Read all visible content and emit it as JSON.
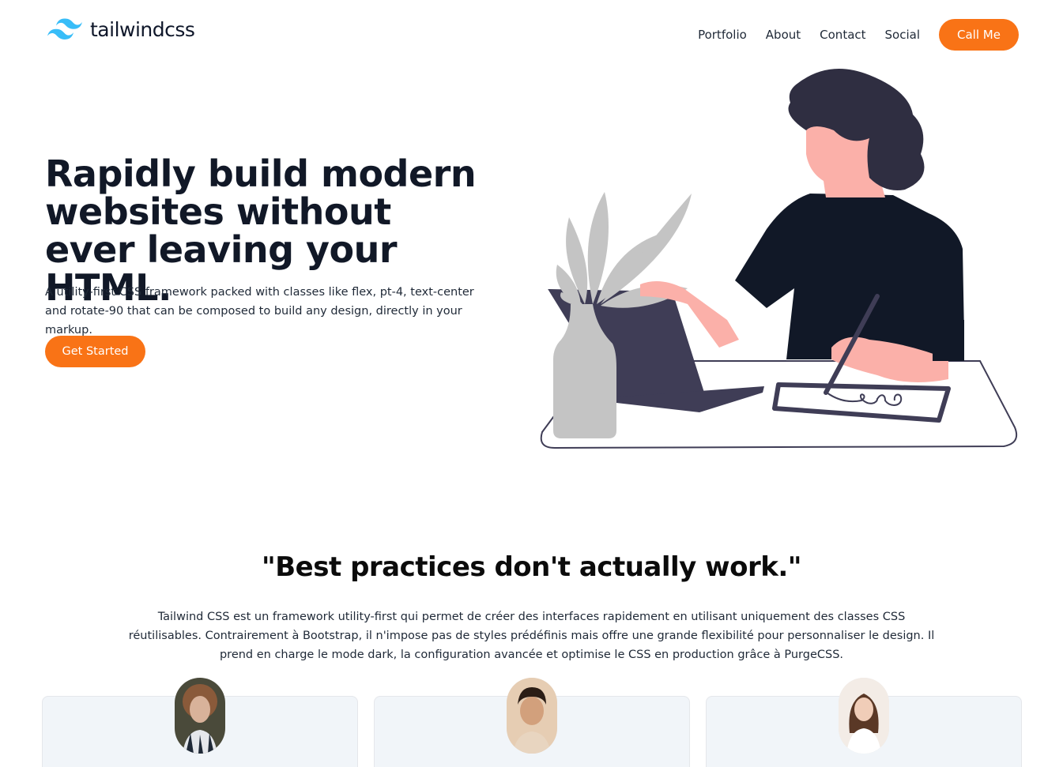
{
  "header": {
    "logo_text": "tailwindcss",
    "nav": [
      "Portfolio",
      "About",
      "Contact",
      "Social"
    ],
    "cta_label": "Call Me"
  },
  "hero": {
    "title": "Rapidly build modern websites without ever leaving your HTML.",
    "description": "A utility-first CSS framework packed with classes like flex, pt-4, text-center and rotate-90 that can be composed to build any design, directly in your markup.",
    "button_label": "Get Started"
  },
  "quote_section": {
    "quote": "\"Best practices don't actually work.\"",
    "body": "Tailwind CSS est un framework utility-first qui permet de créer des interfaces rapidement en utilisant uniquement des classes CSS réutilisables. Contrairement à Bootstrap, il n'impose pas de styles prédéfinis mais offre une grande flexibilité pour personnaliser le design. Il prend en charge le mode dark, la configuration avancée et optimise le CSS en production grâce à PurgeCSS."
  },
  "testimonials": [
    {
      "avatar": "woman-dark-hair-avatar"
    },
    {
      "avatar": "man-curly-hair-avatar"
    },
    {
      "avatar": "woman-white-shirt-avatar"
    }
  ],
  "colors": {
    "accent": "#f97316",
    "logo": "#38bdf8",
    "text_dark": "#111827",
    "card_bg": "#f1f5f9"
  }
}
